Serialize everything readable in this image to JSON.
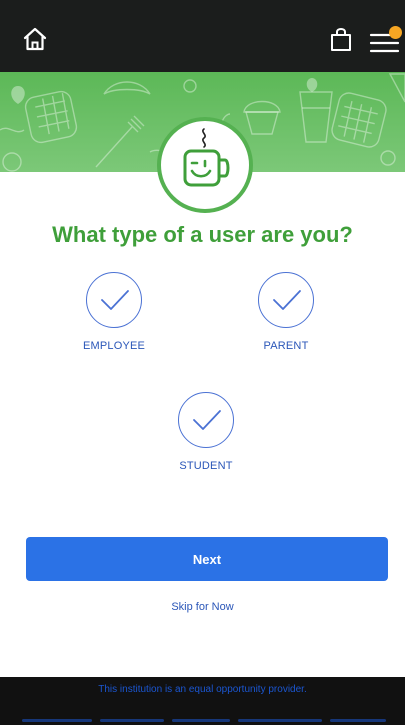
{
  "colors": {
    "topbar": "#1b1d1c",
    "brand_green": "#55b151",
    "title_green": "#3f9f3a",
    "accent_blue": "#2b72e6",
    "option_blue": "#4b72d4",
    "label_blue": "#2a56b8",
    "notification": "#f6a623",
    "footer_bg": "#111111",
    "footer_text": "#1b56d1"
  },
  "header": {
    "home_icon": "home-icon",
    "cart_icon": "shopping-bag-icon",
    "menu_icon": "hamburger-menu-icon"
  },
  "page": {
    "title": "What type of a user are you?"
  },
  "user_types": [
    {
      "label": "EMPLOYEE",
      "selected": true
    },
    {
      "label": "PARENT",
      "selected": true
    },
    {
      "label": "STUDENT",
      "selected": true
    }
  ],
  "actions": {
    "next_label": "Next",
    "skip_label": "Skip for Now"
  },
  "footer": {
    "text": "This institution is an equal opportunity provider."
  }
}
